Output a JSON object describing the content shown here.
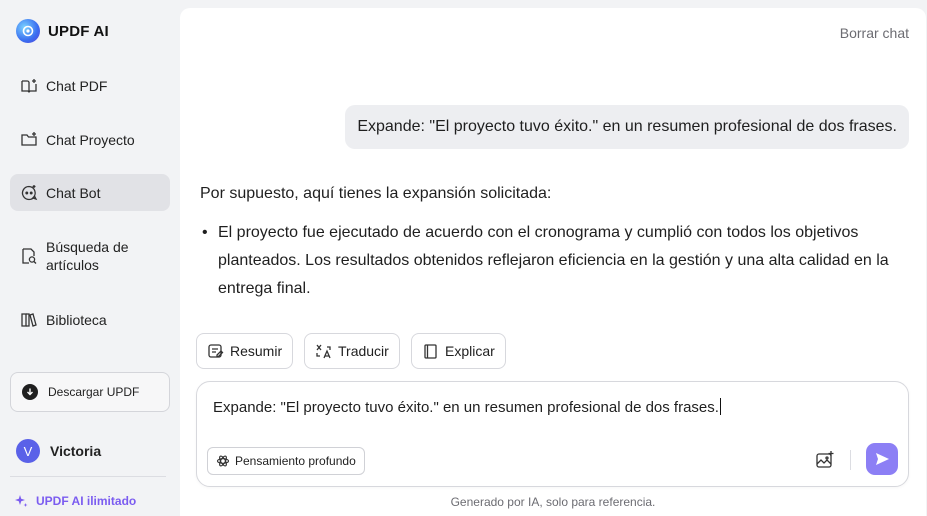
{
  "brand": {
    "name": "UPDF AI",
    "logo_icon": "updf-ai-logo-icon"
  },
  "sidebar": {
    "items": [
      {
        "label": "Chat PDF",
        "icon": "book-sparkle-icon",
        "active": false
      },
      {
        "label": "Chat Proyecto",
        "icon": "folder-sparkle-icon",
        "active": false
      },
      {
        "label": "Chat Bot",
        "icon": "bot-chat-icon",
        "active": true
      },
      {
        "label": "Búsqueda de artículos",
        "icon": "search-document-icon",
        "active": false
      },
      {
        "label": "Biblioteca",
        "icon": "library-icon",
        "active": false
      }
    ],
    "download_label": "Descargar UPDF",
    "user": {
      "initial": "V",
      "name": "Victoria"
    },
    "upgrade_label": "UPDF AI ilimitado"
  },
  "header": {
    "clear_chat": "Borrar chat"
  },
  "conversation": {
    "user_message": "Expande: \"El proyecto tuvo éxito.\" en un resumen profesional de dos frases.",
    "assistant_intro": "Por supuesto, aquí tienes la expansión solicitada:",
    "assistant_bullets": [
      "El proyecto fue ejecutado de acuerdo con el cronograma y cumplió con todos los objetivos planteados. Los resultados obtenidos reflejaron eficiencia en la gestión y una alta calidad en la entrega final."
    ]
  },
  "quick_actions": [
    {
      "label": "Resumir",
      "icon": "summarize-icon"
    },
    {
      "label": "Traducir",
      "icon": "translate-icon"
    },
    {
      "label": "Explicar",
      "icon": "book-icon"
    }
  ],
  "composer": {
    "value": "Expande: \"El proyecto tuvo éxito.\" en un resumen profesional de dos frases.",
    "deep_think_label": "Pensamiento profundo"
  },
  "footer_note": "Generado por IA, solo para referencia.",
  "colors": {
    "accent": "#8c7ff5",
    "upgrade": "#7b5cf0",
    "avatar": "#5a61e8"
  }
}
